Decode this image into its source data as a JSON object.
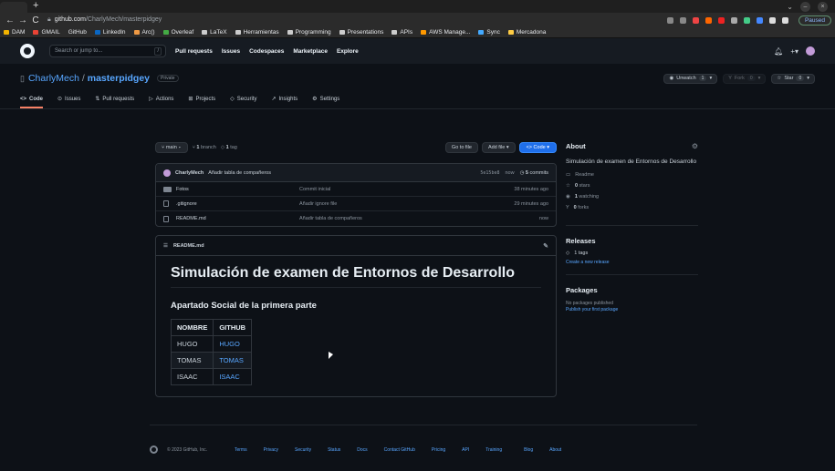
{
  "browser": {
    "new_tab": "+",
    "url_host": "github.com",
    "url_path": "/CharlyMech/masterpidgey",
    "paused": "Paused",
    "bookmarks": [
      "DAM",
      "GMAIL",
      "GitHub",
      "LinkedIn",
      "Arc()",
      "Overleaf",
      "LaTeX",
      "Herramientas",
      "Programming",
      "Presentations",
      "APIs",
      "AWS Manage...",
      "Sync",
      "Mercadona"
    ]
  },
  "header": {
    "search_placeholder": "Search or jump to...",
    "slash": "/",
    "nav": [
      "Pull requests",
      "Issues",
      "Codespaces",
      "Marketplace",
      "Explore"
    ]
  },
  "repo": {
    "owner": "CharlyMech",
    "sep": "/",
    "name": "masterpidgey",
    "visibility": "Private",
    "unwatch_label": "Unwatch",
    "unwatch_count": "1",
    "fork_label": "Fork",
    "fork_count": "0",
    "star_label": "Star",
    "star_count": "0"
  },
  "tabs": [
    "Code",
    "Issues",
    "Pull requests",
    "Actions",
    "Projects",
    "Security",
    "Insights",
    "Settings"
  ],
  "toolbar": {
    "branch": "main",
    "branches_count": "1",
    "branches_label": "branch",
    "tags_count": "1",
    "tags_label": "tag",
    "goto_file": "Go to file",
    "add_file": "Add file",
    "code": "Code"
  },
  "commit": {
    "author": "CharlyMech",
    "message": "Añadir tabla de compañeros",
    "hash": "5e15be8",
    "time": "now",
    "count": "5",
    "count_label": "commits"
  },
  "files": [
    {
      "name": "Fotos",
      "msg": "Commit inicial",
      "time": "38 minutes ago",
      "type": "folder"
    },
    {
      "name": ".gitignore",
      "msg": "Añadir ignore file",
      "time": "29 minutes ago",
      "type": "file"
    },
    {
      "name": "README.md",
      "msg": "Añadir tabla de compañeros",
      "time": "now",
      "type": "file"
    }
  ],
  "readme": {
    "file": "README.md",
    "h1": "Simulación de examen de Entornos de Desarrollo",
    "h2": "Apartado Social de la primera parte",
    "table_headers": [
      "NOMBRE",
      "GITHUB"
    ],
    "table_rows": [
      [
        "HUGO",
        "HUGO"
      ],
      [
        "TOMAS",
        "TOMAS"
      ],
      [
        "ISAAC",
        "ISAAC"
      ]
    ]
  },
  "sidebar": {
    "about": "About",
    "description": "Simulación de examen de Entornos de Desarrollo",
    "readme": "Readme",
    "stars_count": "0",
    "stars_label": "stars",
    "watching_count": "1",
    "watching_label": "watching",
    "forks_count": "0",
    "forks_label": "forks",
    "releases": "Releases",
    "tags": "1 tags",
    "create_release": "Create a new release",
    "packages": "Packages",
    "no_packages": "No packages published",
    "publish_package": "Publish your first package"
  },
  "footer": {
    "copyright": "© 2023 GitHub, Inc.",
    "links": [
      "Terms",
      "Privacy",
      "Security",
      "Status",
      "Docs",
      "Contact GitHub",
      "Pricing",
      "API",
      "Training",
      "Blog",
      "About"
    ]
  }
}
